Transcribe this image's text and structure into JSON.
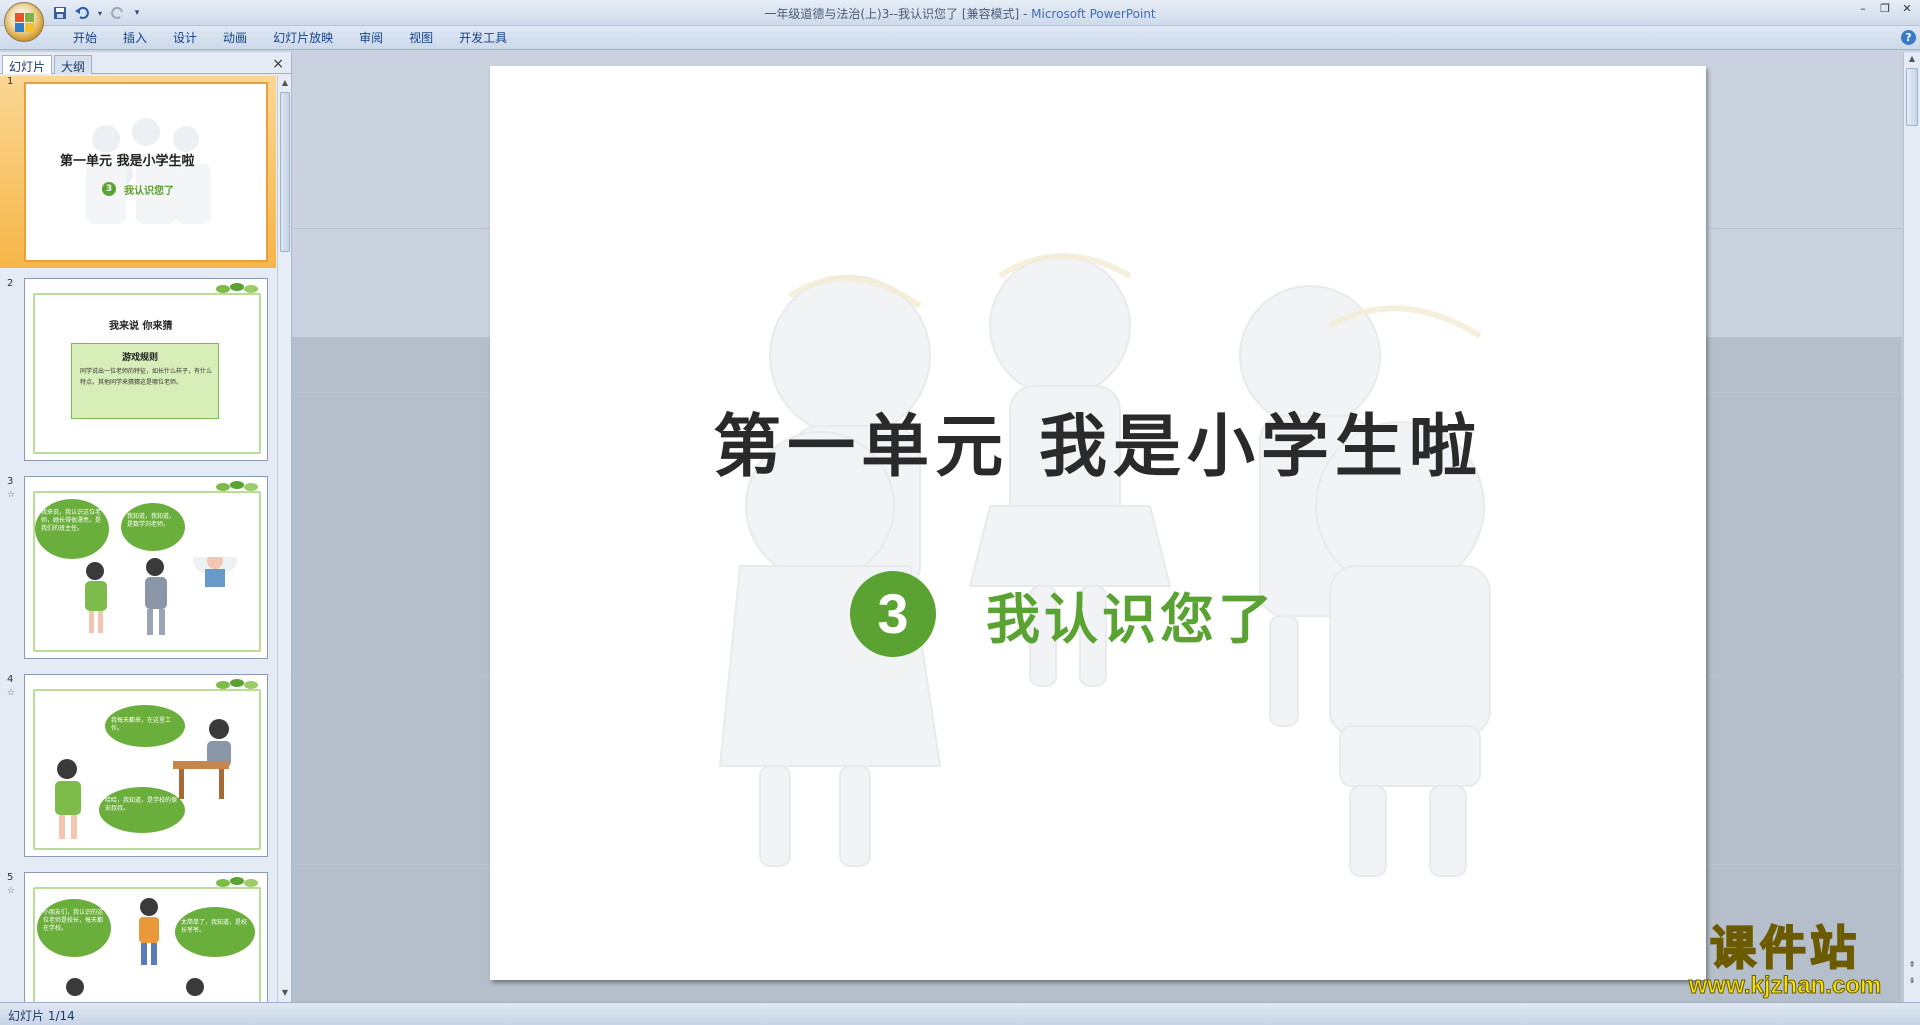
{
  "window": {
    "title": "一年级道德与法治(上)3--我认识您了 [兼容模式] - ",
    "app_name": "Microsoft PowerPoint"
  },
  "quick_access": {
    "save_icon": "save-icon",
    "undo_icon": "undo-icon",
    "redo_icon": "redo-icon",
    "customize_icon": "customize-icon"
  },
  "ribbon": {
    "tabs": [
      "开始",
      "插入",
      "设计",
      "动画",
      "幻灯片放映",
      "审阅",
      "视图",
      "开发工具"
    ]
  },
  "left_panel": {
    "tabs": [
      "幻灯片",
      "大纲"
    ],
    "close_label": "×"
  },
  "thumbnails": [
    {
      "number": "1",
      "title": "第一单元 我是小学生啦",
      "lesson_number": "3",
      "lesson_title": "我认识您了"
    },
    {
      "number": "2",
      "title": "我来说 你来猜",
      "rules_title": "游戏规则",
      "rules_text": "同学说出一位老师的特征，如长什么样子，有什么特点。其他同学来猜猜这是哪位老师。"
    },
    {
      "number": "3",
      "bubble_1": "我来说，我认识这位老师，她长得很漂亮，是我们的班主任。",
      "bubble_2": "我知道，我知道，是数学刘老师。"
    },
    {
      "number": "4",
      "bubble_1": "我每天都来，在这里工作。",
      "bubble_2": "哈哈，我知道，是学校的保安叔叔。"
    },
    {
      "number": "5",
      "bubble_1": "小朋友们，我认识的这位老师是校长，每天都在学校。",
      "bubble_2": "太简单了，我知道，是校长爷爷。"
    }
  ],
  "slide": {
    "title": "第一单元  我是小学生啦",
    "lesson_number": "3",
    "lesson_title": "我认识您了"
  },
  "watermark": {
    "name": "课件站",
    "url": "www.kjzhan.com"
  },
  "status": {
    "slide_counter": "幻灯片 1/14"
  },
  "colors": {
    "accent_green": "#5aa232",
    "selected_thumb": "#f6b648",
    "ribbon_text": "#15428b",
    "watermark_yellow": "#f5e500"
  }
}
